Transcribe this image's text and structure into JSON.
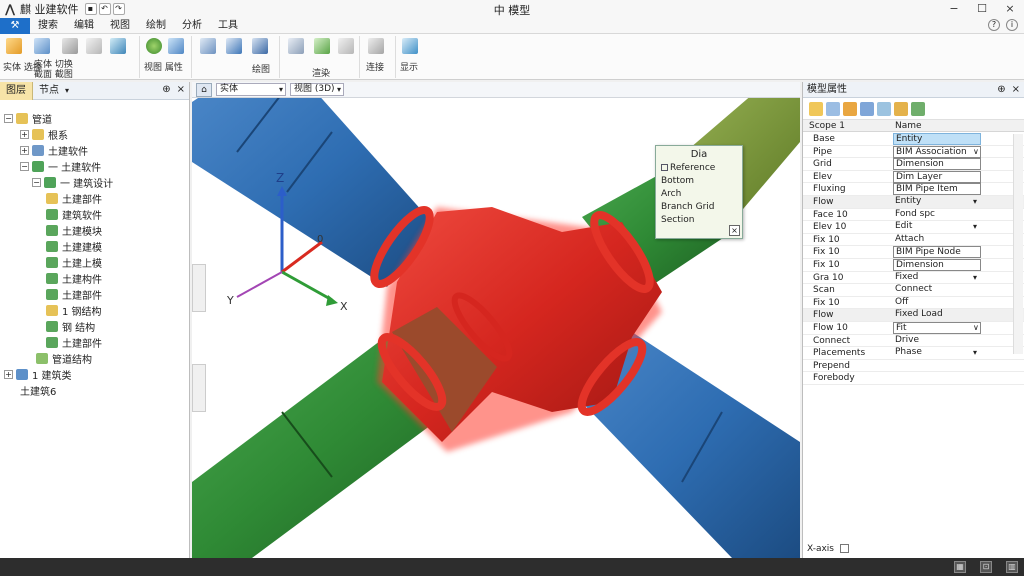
{
  "titlebar": {
    "app_name": "麒 业建软件",
    "center_title": "中 模型",
    "min": "−",
    "max": "☐",
    "close": "×"
  },
  "menubar": {
    "file": "⚒",
    "items": [
      "搜索",
      "编辑",
      "视图",
      "绘制",
      "分析",
      "工具"
    ]
  },
  "ribbon": {
    "labels": {
      "g1_a": "实体 选择",
      "g1_b": "实体 切换 截面 截图",
      "g2": "视图 属性",
      "g3": "绘图",
      "g4": "渲染",
      "g5": "连接",
      "g6": "显示"
    }
  },
  "left_panel": {
    "tab_active": "图层",
    "tab_other": "节点",
    "tree": [
      {
        "label": "管道",
        "level": 0,
        "exp": "−"
      },
      {
        "label": "根系",
        "level": 1,
        "exp": "+"
      },
      {
        "label": "土建软件",
        "level": 1,
        "exp": "+"
      },
      {
        "label": "一 土建软件",
        "level": 1,
        "exp": "−"
      },
      {
        "label": "一 建筑设计",
        "level": 2,
        "exp": "−"
      },
      {
        "label": "土建部件",
        "level": 3,
        "exp": ""
      },
      {
        "label": "建筑软件",
        "level": 3,
        "exp": ""
      },
      {
        "label": "土建模块",
        "level": 3,
        "exp": ""
      },
      {
        "label": "土建建模",
        "level": 3,
        "exp": ""
      },
      {
        "label": "土建上模",
        "level": 3,
        "exp": ""
      },
      {
        "label": "土建构件",
        "level": 3,
        "exp": ""
      },
      {
        "label": "土建部件",
        "level": 3,
        "exp": ""
      },
      {
        "label": "1 钢结构",
        "level": 3,
        "exp": ""
      },
      {
        "label": "钢 结构",
        "level": 3,
        "exp": ""
      },
      {
        "label": "土建部件",
        "level": 3,
        "exp": ""
      },
      {
        "label": "管道结构",
        "level": 2,
        "exp": ""
      },
      {
        "label": "1 建筑类",
        "level": 0,
        "exp": "+"
      },
      {
        "label": "土建筑6",
        "level": 0,
        "exp": ""
      }
    ]
  },
  "viewport": {
    "view_select": "实体",
    "mode_select": "视图 (3D)",
    "axis_z": "Z",
    "axis_x": "X",
    "axis_y": "Y",
    "axis_origin": "0",
    "popup": {
      "title": "Dia",
      "items": [
        "Reference",
        "Bottom",
        "Arch",
        "Branch Grid",
        "Section"
      ]
    },
    "colors": {
      "blue": "#2e6db2",
      "red": "#d5261f",
      "green": "#2f8a35",
      "olive": "#7d9a3a",
      "brown": "#9b4a2c"
    }
  },
  "right_panel": {
    "title": "模型属性",
    "col_name": "Scope 1",
    "col_value": "Name",
    "rows": [
      {
        "key": "Base",
        "value": "Entity",
        "cat": false,
        "style": "hl",
        "dd": ""
      },
      {
        "key": "Pipe",
        "value": "BIM Association",
        "cat": false,
        "style": "box",
        "dd": "∨"
      },
      {
        "key": "Grid",
        "value": "Dimension",
        "cat": false,
        "style": "box",
        "dd": ""
      },
      {
        "key": "Elev",
        "value": "Dim Layer",
        "cat": false,
        "style": "box",
        "dd": ""
      },
      {
        "key": "Fluxing",
        "value": "BIM Pipe Item",
        "cat": false,
        "style": "box",
        "dd": ""
      },
      {
        "key": "Flow",
        "value": "Entity",
        "cat": true,
        "style": "",
        "dd": "▾"
      },
      {
        "key": "Face 10",
        "value": "Fond spc",
        "cat": false,
        "style": "",
        "dd": ""
      },
      {
        "key": "Elev 10",
        "value": "Edit",
        "cat": false,
        "style": "",
        "dd": "▾"
      },
      {
        "key": "Fix 10",
        "value": "Attach",
        "cat": false,
        "style": "",
        "dd": ""
      },
      {
        "key": "Fix 10",
        "value": "BIM Pipe Node",
        "cat": false,
        "style": "box",
        "dd": ""
      },
      {
        "key": "Fix 10",
        "value": "Dimension",
        "cat": false,
        "style": "box",
        "dd": ""
      },
      {
        "key": "Gra 10",
        "value": "Fixed",
        "cat": false,
        "style": "",
        "dd": "▾"
      },
      {
        "key": "Scan",
        "value": "Connect",
        "cat": false,
        "style": "",
        "dd": ""
      },
      {
        "key": "Fix 10",
        "value": "Off",
        "cat": false,
        "style": "",
        "dd": ""
      },
      {
        "key": "Flow",
        "value": "Fixed Load",
        "cat": true,
        "style": "",
        "dd": ""
      },
      {
        "key": "Flow 10",
        "value": "Fit",
        "cat": false,
        "style": "box",
        "dd": "∨"
      },
      {
        "key": "Connect",
        "value": "Drive",
        "cat": false,
        "style": "",
        "dd": ""
      },
      {
        "key": "Placements",
        "value": "Phase",
        "cat": false,
        "style": "",
        "dd": "▾"
      },
      {
        "key": "Prepend",
        "value": "",
        "cat": false,
        "style": "",
        "dd": ""
      },
      {
        "key": "Forebody",
        "value": "",
        "cat": false,
        "style": "",
        "dd": ""
      }
    ],
    "bottom": "X-axis"
  }
}
